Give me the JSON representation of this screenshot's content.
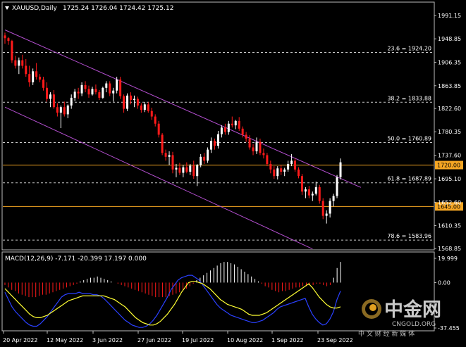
{
  "header": {
    "symbol": "XAUUSD,Daily",
    "ohlc": "1725.24 1726.04 1724.42 1725.12",
    "icon": "triangle-down-icon"
  },
  "macd_header": "MACD(12,26,9) -7.171 -20.399 17.197 0.000",
  "colors": {
    "bull": "#ffffff",
    "bear": "#ff1a1a",
    "channel": "#b44fd0",
    "orange_line": "#f5a623",
    "fib_line": "#c8c8c8",
    "macd_signal": "#ffff33",
    "macd_main": "#2a40ff"
  },
  "watermark": {
    "brand": "中金网",
    "url": "CNGOLD.ORG",
    "tagline": "中 文 财 经 新 媒 体",
    "logo": "cngold-logo-icon"
  },
  "price_labels": {
    "orange_top": "1720.00",
    "orange_bottom": "1645.00"
  },
  "chart_data": {
    "type": "candlestick",
    "title": "XAUUSD,Daily",
    "ylim": [
      1568.85,
      1991.15
    ],
    "y_ticks": [
      "1991.15",
      "1948.85",
      "1906.35",
      "1863.85",
      "1822.60",
      "1780.35",
      "1737.60",
      "1695.10",
      "1652.60",
      "1610.35",
      "1568.85"
    ],
    "x_ticks": [
      "20 Apr 2022",
      "12 May 2022",
      "3 Jun 2022",
      "27 Jun 2022",
      "19 Jul 2022",
      "10 Aug 2022",
      "1 Sep 2022",
      "23 Sep 2022"
    ],
    "candles": [
      {
        "o": 1955,
        "h": 1960,
        "l": 1940,
        "c": 1950
      },
      {
        "o": 1950,
        "h": 1952,
        "l": 1938,
        "c": 1945
      },
      {
        "o": 1945,
        "h": 1947,
        "l": 1905,
        "c": 1910
      },
      {
        "o": 1910,
        "h": 1918,
        "l": 1895,
        "c": 1900
      },
      {
        "o": 1900,
        "h": 1915,
        "l": 1885,
        "c": 1910
      },
      {
        "o": 1910,
        "h": 1920,
        "l": 1895,
        "c": 1900
      },
      {
        "o": 1900,
        "h": 1912,
        "l": 1880,
        "c": 1885
      },
      {
        "o": 1885,
        "h": 1900,
        "l": 1862,
        "c": 1870
      },
      {
        "o": 1870,
        "h": 1895,
        "l": 1865,
        "c": 1890
      },
      {
        "o": 1890,
        "h": 1905,
        "l": 1875,
        "c": 1880
      },
      {
        "o": 1880,
        "h": 1885,
        "l": 1870,
        "c": 1875
      },
      {
        "o": 1875,
        "h": 1880,
        "l": 1855,
        "c": 1860
      },
      {
        "o": 1860,
        "h": 1870,
        "l": 1835,
        "c": 1840
      },
      {
        "o": 1840,
        "h": 1852,
        "l": 1825,
        "c": 1848
      },
      {
        "o": 1848,
        "h": 1856,
        "l": 1822,
        "c": 1825
      },
      {
        "o": 1825,
        "h": 1832,
        "l": 1808,
        "c": 1815
      },
      {
        "o": 1815,
        "h": 1828,
        "l": 1787,
        "c": 1825
      },
      {
        "o": 1825,
        "h": 1835,
        "l": 1808,
        "c": 1812
      },
      {
        "o": 1812,
        "h": 1830,
        "l": 1805,
        "c": 1828
      },
      {
        "o": 1828,
        "h": 1848,
        "l": 1822,
        "c": 1842
      },
      {
        "o": 1842,
        "h": 1858,
        "l": 1836,
        "c": 1853
      },
      {
        "o": 1853,
        "h": 1860,
        "l": 1840,
        "c": 1850
      },
      {
        "o": 1850,
        "h": 1870,
        "l": 1845,
        "c": 1865
      },
      {
        "o": 1865,
        "h": 1872,
        "l": 1852,
        "c": 1858
      },
      {
        "o": 1858,
        "h": 1864,
        "l": 1842,
        "c": 1848
      },
      {
        "o": 1848,
        "h": 1862,
        "l": 1846,
        "c": 1858
      },
      {
        "o": 1858,
        "h": 1866,
        "l": 1848,
        "c": 1852
      },
      {
        "o": 1852,
        "h": 1856,
        "l": 1838,
        "c": 1842
      },
      {
        "o": 1842,
        "h": 1862,
        "l": 1840,
        "c": 1860
      },
      {
        "o": 1860,
        "h": 1872,
        "l": 1852,
        "c": 1868
      },
      {
        "o": 1868,
        "h": 1872,
        "l": 1845,
        "c": 1850
      },
      {
        "o": 1850,
        "h": 1860,
        "l": 1835,
        "c": 1855
      },
      {
        "o": 1855,
        "h": 1880,
        "l": 1850,
        "c": 1875
      },
      {
        "o": 1875,
        "h": 1880,
        "l": 1840,
        "c": 1845
      },
      {
        "o": 1845,
        "h": 1848,
        "l": 1815,
        "c": 1822
      },
      {
        "o": 1822,
        "h": 1850,
        "l": 1818,
        "c": 1846
      },
      {
        "o": 1846,
        "h": 1852,
        "l": 1830,
        "c": 1838
      },
      {
        "o": 1838,
        "h": 1846,
        "l": 1825,
        "c": 1840
      },
      {
        "o": 1840,
        "h": 1844,
        "l": 1822,
        "c": 1828
      },
      {
        "o": 1828,
        "h": 1832,
        "l": 1815,
        "c": 1820
      },
      {
        "o": 1820,
        "h": 1834,
        "l": 1816,
        "c": 1830
      },
      {
        "o": 1830,
        "h": 1834,
        "l": 1815,
        "c": 1818
      },
      {
        "o": 1818,
        "h": 1824,
        "l": 1802,
        "c": 1808
      },
      {
        "o": 1808,
        "h": 1812,
        "l": 1790,
        "c": 1795
      },
      {
        "o": 1795,
        "h": 1800,
        "l": 1770,
        "c": 1775
      },
      {
        "o": 1775,
        "h": 1778,
        "l": 1738,
        "c": 1742
      },
      {
        "o": 1742,
        "h": 1748,
        "l": 1728,
        "c": 1735
      },
      {
        "o": 1735,
        "h": 1745,
        "l": 1720,
        "c": 1738
      },
      {
        "o": 1738,
        "h": 1744,
        "l": 1705,
        "c": 1712
      },
      {
        "o": 1712,
        "h": 1722,
        "l": 1698,
        "c": 1715
      },
      {
        "o": 1715,
        "h": 1724,
        "l": 1702,
        "c": 1706
      },
      {
        "o": 1706,
        "h": 1720,
        "l": 1698,
        "c": 1716
      },
      {
        "o": 1716,
        "h": 1725,
        "l": 1705,
        "c": 1708
      },
      {
        "o": 1708,
        "h": 1722,
        "l": 1702,
        "c": 1719
      },
      {
        "o": 1719,
        "h": 1728,
        "l": 1695,
        "c": 1700
      },
      {
        "o": 1700,
        "h": 1722,
        "l": 1682,
        "c": 1720
      },
      {
        "o": 1720,
        "h": 1740,
        "l": 1716,
        "c": 1735
      },
      {
        "o": 1735,
        "h": 1742,
        "l": 1722,
        "c": 1728
      },
      {
        "o": 1728,
        "h": 1752,
        "l": 1724,
        "c": 1748
      },
      {
        "o": 1748,
        "h": 1770,
        "l": 1742,
        "c": 1764
      },
      {
        "o": 1764,
        "h": 1768,
        "l": 1748,
        "c": 1755
      },
      {
        "o": 1755,
        "h": 1782,
        "l": 1750,
        "c": 1776
      },
      {
        "o": 1776,
        "h": 1792,
        "l": 1770,
        "c": 1788
      },
      {
        "o": 1788,
        "h": 1795,
        "l": 1775,
        "c": 1780
      },
      {
        "o": 1780,
        "h": 1800,
        "l": 1775,
        "c": 1795
      },
      {
        "o": 1795,
        "h": 1808,
        "l": 1788,
        "c": 1792
      },
      {
        "o": 1792,
        "h": 1802,
        "l": 1785,
        "c": 1800
      },
      {
        "o": 1800,
        "h": 1807,
        "l": 1782,
        "c": 1786
      },
      {
        "o": 1786,
        "h": 1790,
        "l": 1770,
        "c": 1775
      },
      {
        "o": 1775,
        "h": 1780,
        "l": 1762,
        "c": 1768
      },
      {
        "o": 1768,
        "h": 1774,
        "l": 1748,
        "c": 1752
      },
      {
        "o": 1752,
        "h": 1758,
        "l": 1738,
        "c": 1745
      },
      {
        "o": 1745,
        "h": 1770,
        "l": 1740,
        "c": 1762
      },
      {
        "o": 1762,
        "h": 1768,
        "l": 1738,
        "c": 1742
      },
      {
        "o": 1742,
        "h": 1750,
        "l": 1732,
        "c": 1738
      },
      {
        "o": 1738,
        "h": 1742,
        "l": 1718,
        "c": 1722
      },
      {
        "o": 1722,
        "h": 1728,
        "l": 1705,
        "c": 1712
      },
      {
        "o": 1712,
        "h": 1718,
        "l": 1695,
        "c": 1700
      },
      {
        "o": 1700,
        "h": 1718,
        "l": 1694,
        "c": 1714
      },
      {
        "o": 1714,
        "h": 1720,
        "l": 1702,
        "c": 1708
      },
      {
        "o": 1708,
        "h": 1715,
        "l": 1700,
        "c": 1712
      },
      {
        "o": 1712,
        "h": 1728,
        "l": 1708,
        "c": 1722
      },
      {
        "o": 1722,
        "h": 1740,
        "l": 1718,
        "c": 1728
      },
      {
        "o": 1728,
        "h": 1732,
        "l": 1708,
        "c": 1712
      },
      {
        "o": 1712,
        "h": 1716,
        "l": 1696,
        "c": 1700
      },
      {
        "o": 1700,
        "h": 1704,
        "l": 1666,
        "c": 1672
      },
      {
        "o": 1672,
        "h": 1680,
        "l": 1660,
        "c": 1676
      },
      {
        "o": 1676,
        "h": 1682,
        "l": 1660,
        "c": 1665
      },
      {
        "o": 1665,
        "h": 1672,
        "l": 1655,
        "c": 1668
      },
      {
        "o": 1668,
        "h": 1690,
        "l": 1665,
        "c": 1680
      },
      {
        "o": 1680,
        "h": 1684,
        "l": 1650,
        "c": 1655
      },
      {
        "o": 1655,
        "h": 1660,
        "l": 1622,
        "c": 1628
      },
      {
        "o": 1628,
        "h": 1638,
        "l": 1614,
        "c": 1632
      },
      {
        "o": 1632,
        "h": 1660,
        "l": 1625,
        "c": 1655
      },
      {
        "o": 1655,
        "h": 1668,
        "l": 1645,
        "c": 1664
      },
      {
        "o": 1664,
        "h": 1702,
        "l": 1660,
        "c": 1698
      },
      {
        "o": 1698,
        "h": 1732,
        "l": 1694,
        "c": 1725
      }
    ],
    "lines": [
      {
        "kind": "horizontal",
        "value": 1720.0,
        "color": "#f5a623"
      },
      {
        "kind": "horizontal",
        "value": 1645.0,
        "color": "#f5a623"
      }
    ],
    "fibonacci": [
      {
        "label": "23.6 = 1924.20",
        "value": 1924.2
      },
      {
        "label": "38.2 = 1833.88",
        "value": 1833.88
      },
      {
        "label": "50.0 = 1760.89",
        "value": 1760.89
      },
      {
        "label": "61.8 = 1687.89",
        "value": 1687.89
      },
      {
        "label": "78.6 = 1583.96",
        "value": 1583.96
      }
    ],
    "channel": [
      {
        "start": {
          "index": 0,
          "price": 1965
        },
        "end": {
          "index": 97,
          "price": 1693
        }
      },
      {
        "start": {
          "index": 0,
          "price": 1825
        },
        "end": {
          "index": 88,
          "price": 1568
        }
      }
    ],
    "macd": {
      "title": "MACD(12,26,9) -7.171 -20.399 17.197 0.000",
      "y_ticks": [
        "19.999",
        "0.00",
        "-37.455"
      ],
      "ylim": [
        -37.455,
        19.999
      ],
      "histogram": [
        -2,
        -4,
        -6,
        -7,
        -9,
        -10,
        -11,
        -12,
        -12,
        -12,
        -11,
        -10,
        -10,
        -9,
        -8,
        -7,
        -6,
        -5,
        -4,
        -3,
        -2,
        -1,
        1,
        2,
        3,
        4,
        4,
        5,
        4,
        3,
        2,
        1,
        0,
        -1,
        -2,
        -3,
        -4,
        -5,
        -6,
        -7,
        -8,
        -9,
        -10,
        -11,
        -12,
        -12,
        -12,
        -12,
        -11,
        -10,
        -9,
        -8,
        -7,
        -5,
        -3,
        -1,
        2,
        4,
        6,
        8,
        10,
        12,
        14,
        16,
        17,
        17,
        16,
        15,
        13,
        11,
        9,
        7,
        5,
        3,
        1,
        -1,
        -3,
        -4,
        -6,
        -7,
        -8,
        -7,
        -7,
        -6,
        -5,
        -4,
        -4,
        -3,
        -3,
        -2,
        -2,
        -1,
        -1,
        -2,
        -3,
        -2,
        4,
        12,
        17
      ],
      "signal": [
        -5,
        -8,
        -11,
        -14,
        -17,
        -20,
        -23,
        -26,
        -28,
        -29,
        -29,
        -28,
        -27,
        -25,
        -23,
        -21,
        -19,
        -17,
        -15,
        -14,
        -13,
        -12,
        -11,
        -11,
        -11,
        -11,
        -11,
        -11,
        -11,
        -12,
        -13,
        -14,
        -16,
        -18,
        -20,
        -23,
        -26,
        -29,
        -31,
        -33,
        -34,
        -35,
        -35,
        -34,
        -32,
        -29,
        -26,
        -22,
        -18,
        -13,
        -8,
        -4,
        0,
        1,
        1,
        0,
        -1,
        -3,
        -5,
        -8,
        -11,
        -14,
        -16,
        -18,
        -19,
        -20,
        -21,
        -22,
        -24,
        -26,
        -27,
        -27,
        -27,
        -26,
        -25,
        -23,
        -21,
        -19,
        -17,
        -15,
        -13,
        -11,
        -9,
        -7,
        -5,
        -3,
        -1,
        -4,
        -8,
        -12,
        -15,
        -18,
        -20,
        -21,
        -21,
        -20
      ],
      "main": [
        -8,
        -14,
        -20,
        -24,
        -27,
        -30,
        -33,
        -35,
        -36,
        -36,
        -34,
        -31,
        -28,
        -24,
        -20,
        -16,
        -12,
        -10,
        -9,
        -9,
        -9,
        -8,
        -9,
        -9,
        -9,
        -10,
        -10,
        -11,
        -13,
        -16,
        -19,
        -22,
        -25,
        -28,
        -31,
        -33,
        -35,
        -36,
        -37,
        -37,
        -36,
        -34,
        -31,
        -27,
        -22,
        -17,
        -12,
        -6,
        -2,
        2,
        4,
        5,
        6,
        6,
        4,
        2,
        -2,
        -6,
        -10,
        -14,
        -18,
        -21,
        -23,
        -25,
        -27,
        -28,
        -29,
        -30,
        -31,
        -32,
        -33,
        -33,
        -32,
        -31,
        -29,
        -27,
        -25,
        -22,
        -20,
        -19,
        -18,
        -17,
        -16,
        -15,
        -14,
        -13,
        -20,
        -26,
        -30,
        -33,
        -35,
        -34,
        -30,
        -24,
        -14,
        -7
      ]
    }
  }
}
